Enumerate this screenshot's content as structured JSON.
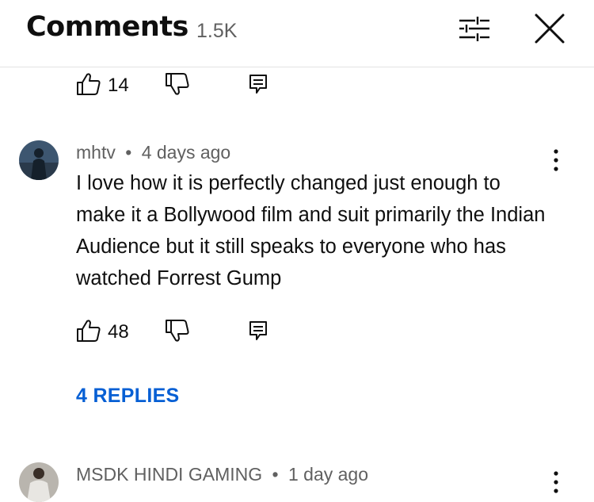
{
  "header": {
    "title": "Comments",
    "count": "1.5K",
    "filter_icon": "filter-sliders-icon",
    "close_icon": "close-icon"
  },
  "comments": [
    {
      "likes": "14"
    },
    {
      "author": "mhtv",
      "time": "4 days ago",
      "text": "I love how it is perfectly changed just enough to make it a Bollywood film and suit primarily the Indian Audience but it still speaks to everyone who has watched Forrest Gump",
      "likes": "48",
      "replies_label": "4 REPLIES"
    },
    {
      "author": "MSDK HINDI GAMING",
      "time": "1 day ago"
    }
  ],
  "separator": "•",
  "colors": {
    "link": "#065fd4",
    "secondary_text": "#606060",
    "primary_text": "#0f0f0f"
  }
}
